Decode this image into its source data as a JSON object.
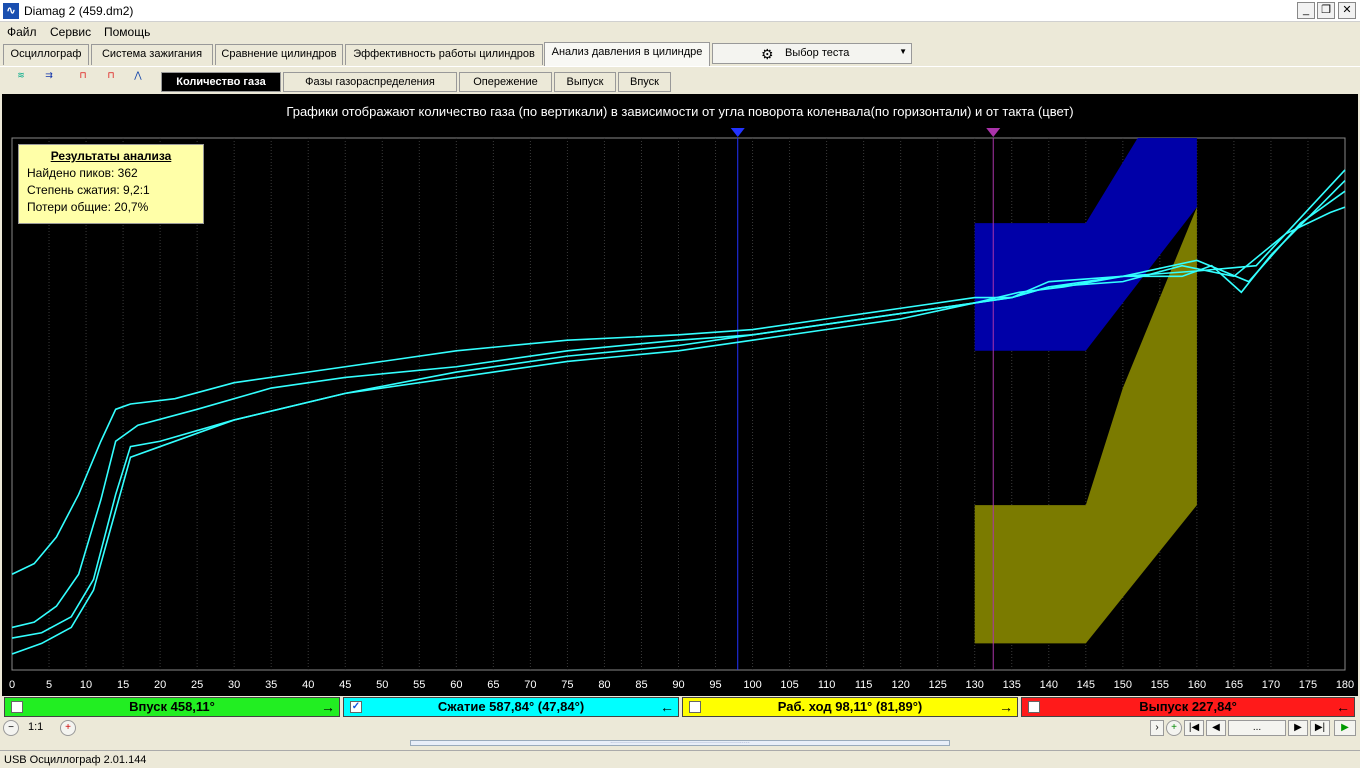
{
  "window": {
    "title": "Diamag 2 (459.dm2)",
    "icon": "oscilloscope-app-icon"
  },
  "menu": [
    "Файл",
    "Сервис",
    "Помощь"
  ],
  "tabs": [
    {
      "label": "Осциллограф"
    },
    {
      "label": "Система зажигания"
    },
    {
      "label": "Сравнение цилиндров"
    },
    {
      "label": "Эффективность работы цилиндров"
    },
    {
      "label": "Анализ давления в цилиндре",
      "active": true
    }
  ],
  "test_select": {
    "label": "Выбор теста"
  },
  "subtabs": [
    {
      "label": "Количество газа",
      "active": true
    },
    {
      "label": "Фазы газораспределения"
    },
    {
      "label": "Опережение"
    },
    {
      "label": "Выпуск"
    },
    {
      "label": "Впуск"
    }
  ],
  "chart_caption": "Графики отображают количество газа (по вертикали) в зависимости от угла поворота коленвала(по горизонтали) и от такта (цвет)",
  "results": {
    "title": "Результаты анализа",
    "peaks": "Найдено пиков: 362",
    "compression": "Степень сжатия: 9,2:1",
    "losses": "Потери общие: 20,7%"
  },
  "phases": [
    {
      "label": "Впуск 458,11°",
      "color": "#22ee22",
      "checked": false,
      "arrow": "→"
    },
    {
      "label": "Сжатие 587,84° (47,84°)",
      "color": "#00ffff",
      "checked": true,
      "arrow": "←"
    },
    {
      "label": "Раб. ход 98,11° (81,89°)",
      "color": "#ffff00",
      "checked": false,
      "arrow": "→"
    },
    {
      "label": "Выпуск 227,84°",
      "color": "#ff1a1a",
      "checked": false,
      "arrow": "←"
    }
  ],
  "nav": {
    "zoom": "1:1",
    "dots": "..."
  },
  "status": "USB Осциллограф  2.01.144",
  "chart_data": {
    "type": "line",
    "xlabel": "",
    "ylabel": "",
    "xlim": [
      0,
      180
    ],
    "ylim": [
      0,
      1
    ],
    "xticks": [
      0,
      5,
      10,
      15,
      20,
      25,
      30,
      35,
      40,
      45,
      50,
      55,
      60,
      65,
      70,
      75,
      80,
      85,
      90,
      95,
      100,
      105,
      110,
      115,
      120,
      125,
      130,
      135,
      140,
      145,
      150,
      155,
      160,
      165,
      170,
      175,
      180
    ],
    "markers": [
      {
        "x": 98,
        "color": "#2233ff"
      },
      {
        "x": 132.5,
        "color": "#aa33aa"
      }
    ],
    "zones": [
      {
        "color": "#0000a8",
        "points": [
          [
            130,
            0.84
          ],
          [
            145,
            0.84
          ],
          [
            152,
            1.0
          ],
          [
            160,
            1.0
          ],
          [
            160,
            0.87
          ],
          [
            145,
            0.6
          ],
          [
            130,
            0.6
          ]
        ]
      },
      {
        "color": "#7b7b00",
        "points": [
          [
            130,
            0.31
          ],
          [
            145,
            0.31
          ],
          [
            150,
            0.53
          ],
          [
            160,
            0.87
          ],
          [
            160,
            0.31
          ],
          [
            145,
            0.05
          ],
          [
            130,
            0.05
          ]
        ]
      }
    ],
    "series": [
      {
        "color": "#33ffff",
        "values": [
          [
            0,
            0.18
          ],
          [
            3,
            0.2
          ],
          [
            6,
            0.25
          ],
          [
            9,
            0.33
          ],
          [
            12,
            0.43
          ],
          [
            14,
            0.49
          ],
          [
            16,
            0.5
          ],
          [
            22,
            0.51
          ],
          [
            30,
            0.54
          ],
          [
            45,
            0.57
          ],
          [
            60,
            0.6
          ],
          [
            75,
            0.62
          ],
          [
            90,
            0.63
          ],
          [
            100,
            0.64
          ],
          [
            110,
            0.66
          ],
          [
            120,
            0.68
          ],
          [
            130,
            0.7
          ],
          [
            135,
            0.7
          ],
          [
            140,
            0.73
          ],
          [
            150,
            0.74
          ],
          [
            158,
            0.74
          ],
          [
            162,
            0.76
          ],
          [
            166,
            0.71
          ],
          [
            170,
            0.78
          ],
          [
            175,
            0.85
          ],
          [
            180,
            0.92
          ]
        ]
      },
      {
        "color": "#33ffff",
        "values": [
          [
            0,
            0.08
          ],
          [
            3,
            0.09
          ],
          [
            6,
            0.12
          ],
          [
            9,
            0.18
          ],
          [
            12,
            0.32
          ],
          [
            14,
            0.43
          ],
          [
            17,
            0.46
          ],
          [
            25,
            0.49
          ],
          [
            35,
            0.53
          ],
          [
            45,
            0.55
          ],
          [
            60,
            0.57
          ],
          [
            75,
            0.6
          ],
          [
            90,
            0.62
          ],
          [
            100,
            0.63
          ],
          [
            110,
            0.65
          ],
          [
            120,
            0.67
          ],
          [
            130,
            0.69
          ],
          [
            135,
            0.7
          ],
          [
            140,
            0.72
          ],
          [
            150,
            0.73
          ],
          [
            158,
            0.76
          ],
          [
            165,
            0.74
          ],
          [
            172,
            0.82
          ],
          [
            178,
            0.86
          ],
          [
            180,
            0.87
          ]
        ]
      },
      {
        "color": "#33ffff",
        "values": [
          [
            0,
            0.06
          ],
          [
            4,
            0.07
          ],
          [
            8,
            0.1
          ],
          [
            11,
            0.17
          ],
          [
            14,
            0.33
          ],
          [
            16,
            0.42
          ],
          [
            20,
            0.43
          ],
          [
            30,
            0.47
          ],
          [
            45,
            0.52
          ],
          [
            60,
            0.55
          ],
          [
            75,
            0.58
          ],
          [
            90,
            0.6
          ],
          [
            100,
            0.62
          ],
          [
            110,
            0.64
          ],
          [
            120,
            0.66
          ],
          [
            130,
            0.69
          ],
          [
            135,
            0.7
          ],
          [
            140,
            0.72
          ],
          [
            150,
            0.74
          ],
          [
            160,
            0.77
          ],
          [
            167,
            0.73
          ],
          [
            174,
            0.84
          ],
          [
            180,
            0.9
          ]
        ]
      },
      {
        "color": "#33ffff",
        "values": [
          [
            0,
            0.03
          ],
          [
            4,
            0.05
          ],
          [
            8,
            0.08
          ],
          [
            11,
            0.15
          ],
          [
            14,
            0.3
          ],
          [
            16,
            0.4
          ],
          [
            20,
            0.42
          ],
          [
            30,
            0.47
          ],
          [
            45,
            0.52
          ],
          [
            60,
            0.56
          ],
          [
            75,
            0.59
          ],
          [
            90,
            0.61
          ],
          [
            100,
            0.63
          ],
          [
            110,
            0.65
          ],
          [
            120,
            0.67
          ],
          [
            130,
            0.69
          ],
          [
            136,
            0.71
          ],
          [
            142,
            0.72
          ],
          [
            150,
            0.74
          ],
          [
            160,
            0.75
          ],
          [
            168,
            0.76
          ],
          [
            176,
            0.88
          ],
          [
            180,
            0.94
          ]
        ]
      }
    ]
  }
}
